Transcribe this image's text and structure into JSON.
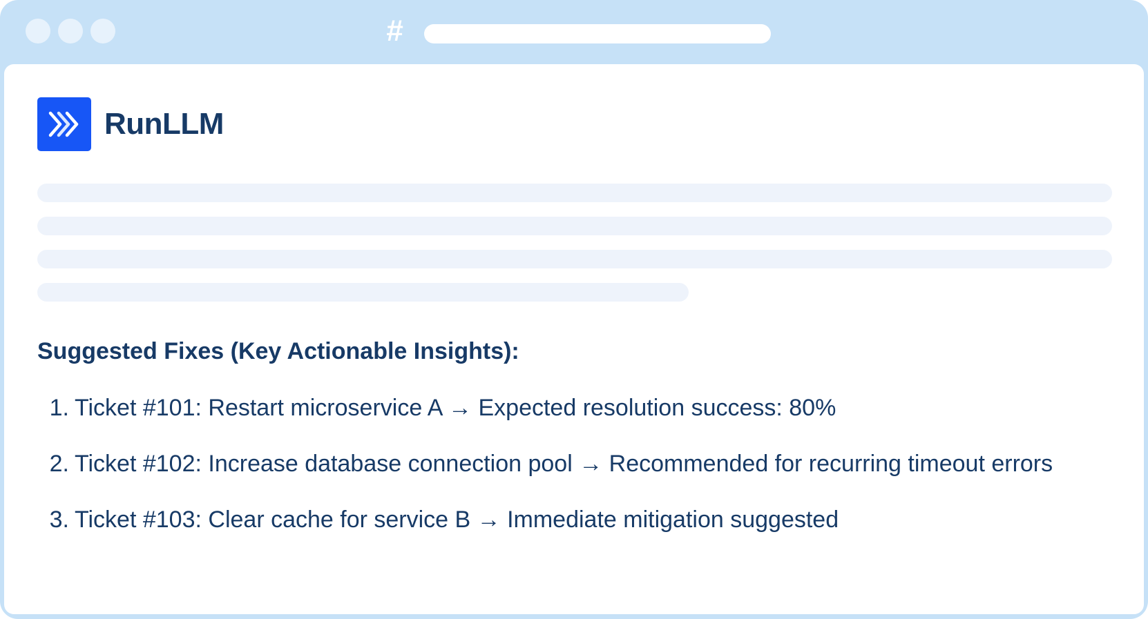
{
  "browser": {
    "dots": [
      "window-dot",
      "window-dot",
      "window-dot"
    ],
    "hash_symbol": "#",
    "url": ""
  },
  "brand": {
    "name": "RunLLM",
    "logo_color": "#1756f6",
    "icon": "double-chevron-right-icon"
  },
  "content": {
    "heading": "Suggested Fixes (Key Actionable Insights):",
    "fixes": [
      {
        "number": "1.",
        "text": "Ticket #101: Restart microservice A → Expected resolution success: 80%"
      },
      {
        "number": "2.",
        "text": "Ticket #102: Increase database connection pool → Recommended for recurring timeout errors"
      },
      {
        "number": "3.",
        "text": "Ticket #103: Clear cache for service B → Immediate mitigation suggested"
      }
    ]
  },
  "colors": {
    "frame": "#c6e1f7",
    "text": "#173a66",
    "skeleton": "#eef3fb"
  }
}
